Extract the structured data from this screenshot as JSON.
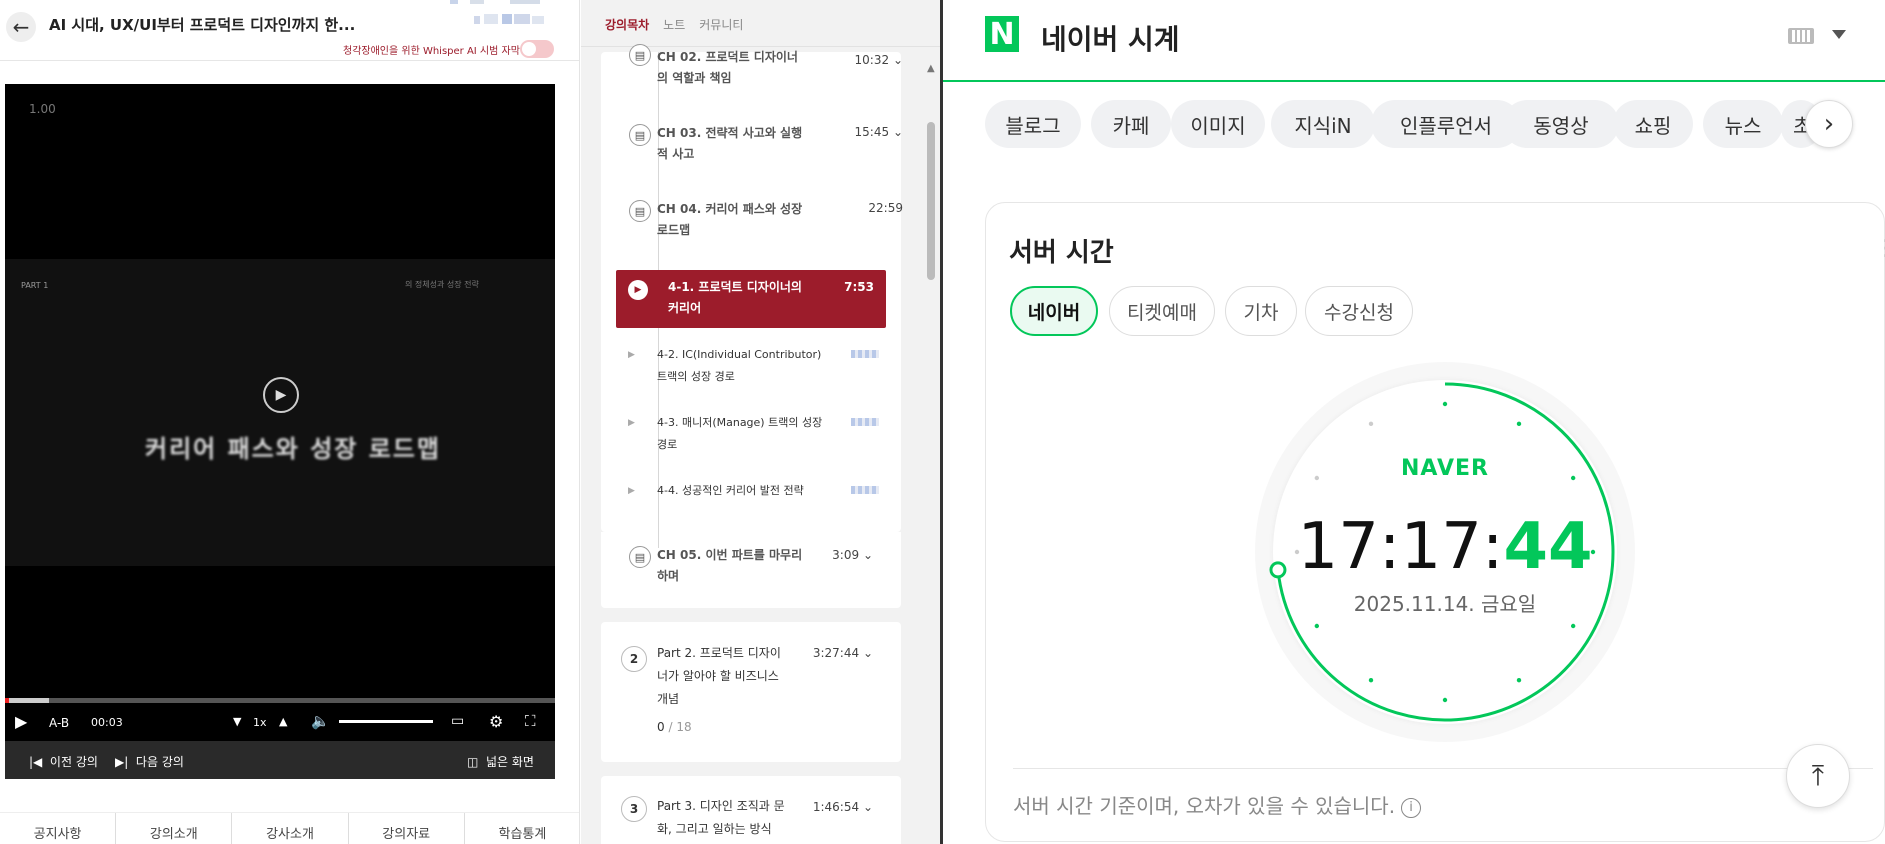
{
  "left": {
    "course_title": "AI 시대, UX/UI부터 프로덕트 디자인까지 한...",
    "whisper_label": "청각장애인을 위한 Whisper AI 시범 자막",
    "player": {
      "speed_indicator": "1.00",
      "part_label": "PART 1",
      "slide_subtitle": "의 정체성과 성장 전략",
      "slide_title": "커리어 패스와 성장 로드맵",
      "progress": 0.08,
      "controls": {
        "ab": "A-B",
        "time": "00:03",
        "speed": "1x"
      },
      "prev_lecture": "이전 강의",
      "next_lecture": "다음 강의",
      "wide_screen": "넓은 화면"
    },
    "bottom_tabs": [
      "공지사항",
      "강의소개",
      "강사소개",
      "강의자료",
      "학습통계"
    ]
  },
  "mid": {
    "tabs": [
      "강의목차",
      "노트",
      "커뮤니티"
    ],
    "active_tab": "강의목차",
    "chapters": [
      {
        "title": "CH 02. 프로덕트 디자이너의 역할과 책임",
        "time": "10:32"
      },
      {
        "title": "CH 03. 전략적 사고와 실행적 사고",
        "time": "15:45"
      },
      {
        "title": "CH 04. 커리어 패스와 성장 로드맵",
        "time": "22:59"
      }
    ],
    "active_lesson": {
      "title": "4-1. 프로덕트 디자이너의 커리어",
      "time": "7:53"
    },
    "lessons": [
      {
        "title": "4-2. IC(Individual Contributor) 트랙의 성장 경로"
      },
      {
        "title": "4-3. 매니저(Manage) 트랙의 성장 경로"
      },
      {
        "title": "4-4. 성공적인 커리어 발전 전략"
      }
    ],
    "ch05": {
      "title": "CH 05. 이번 파트를 마무리하며",
      "time": "3:09"
    },
    "parts": [
      {
        "num": "2",
        "title": "Part 2. 프로덕트 디자이너가 알아야 할 비즈니스 개념",
        "time": "3:27:44",
        "progress_done": "0",
        "progress_total": "/ 18"
      },
      {
        "num": "3",
        "title": "Part 3. 디자인 조직과 문화, 그리고 일하는 방식",
        "time": "1:46:54"
      }
    ]
  },
  "right": {
    "logo": "N",
    "title": "네이버 시계",
    "categories": [
      "블로그",
      "카페",
      "이미지",
      "지식iN",
      "인플루언서",
      "동영상",
      "쇼핑",
      "뉴스",
      "초"
    ],
    "section_title": "서버 시간",
    "sub_tabs": [
      "네이버",
      "티켓예매",
      "기차",
      "수강신청"
    ],
    "active_sub_tab": "네이버",
    "clock": {
      "brand": "NAVER",
      "time_hm": "17:17:",
      "time_s": "44",
      "date": "2025.11.14. 금요일",
      "seconds_progress": 0.733
    },
    "disclaimer": "서버 시간 기준이며, 오차가 있을 수 있습니다.",
    "colors": {
      "naver_green": "#03c75a",
      "lecture_red": "#9c1c2b"
    }
  }
}
